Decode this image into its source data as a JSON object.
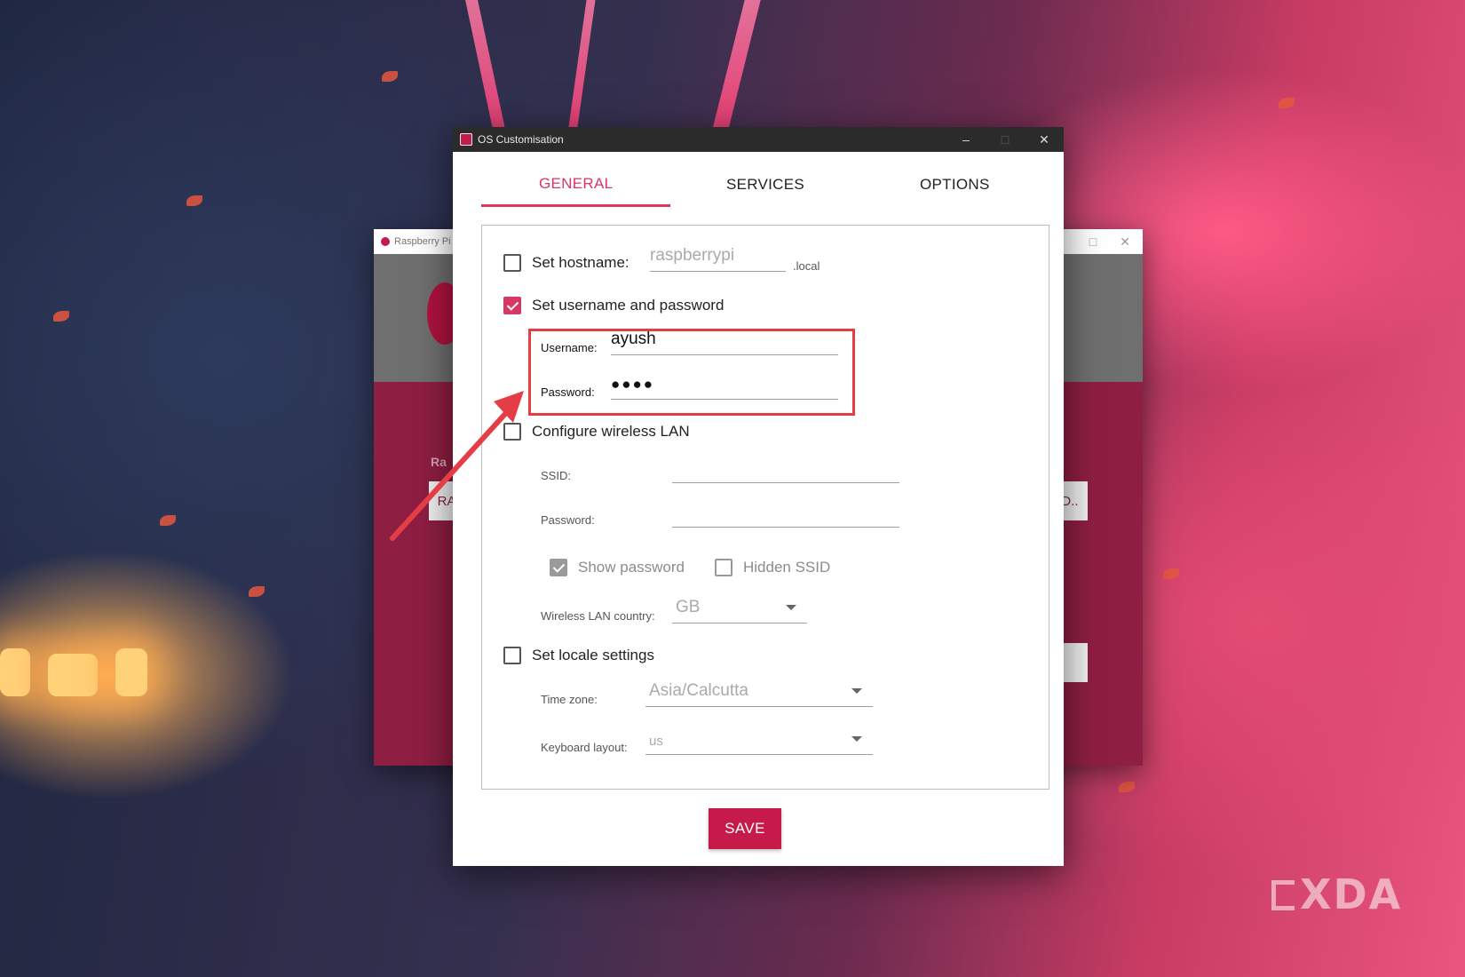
{
  "background_window": {
    "title": "Raspberry Pi",
    "side_label": "Ra",
    "left_button": "RA",
    "right_button": "D.."
  },
  "dialog": {
    "title": "OS Customisation",
    "controls": {
      "minimize": "–",
      "maximize": "□",
      "close": "✕"
    },
    "tabs": [
      {
        "label": "GENERAL",
        "active": true
      },
      {
        "label": "SERVICES",
        "active": false
      },
      {
        "label": "OPTIONS",
        "active": false
      }
    ],
    "general": {
      "hostname": {
        "label": "Set hostname:",
        "checked": false,
        "value": "raspberrypi",
        "suffix": ".local"
      },
      "user": {
        "label": "Set username and password",
        "checked": true,
        "username_label": "Username:",
        "username_value": "ayush",
        "password_label": "Password:",
        "password_value": "●●●●"
      },
      "wlan": {
        "label": "Configure wireless LAN",
        "checked": false,
        "ssid_label": "SSID:",
        "ssid_value": "",
        "password_label": "Password:",
        "password_value": "",
        "show_password": {
          "label": "Show password",
          "checked": true
        },
        "hidden_ssid": {
          "label": "Hidden SSID",
          "checked": false
        },
        "country_label": "Wireless LAN country:",
        "country_value": "GB"
      },
      "locale": {
        "label": "Set locale settings",
        "checked": false,
        "timezone_label": "Time zone:",
        "timezone_value": "Asia/Calcutta",
        "keyboard_label": "Keyboard layout:",
        "keyboard_value": "us"
      }
    },
    "save_label": "SAVE"
  },
  "colors": {
    "accent": "#d93763",
    "save": "#c51a4a",
    "highlight": "#e43d45"
  },
  "watermark": "XDA"
}
